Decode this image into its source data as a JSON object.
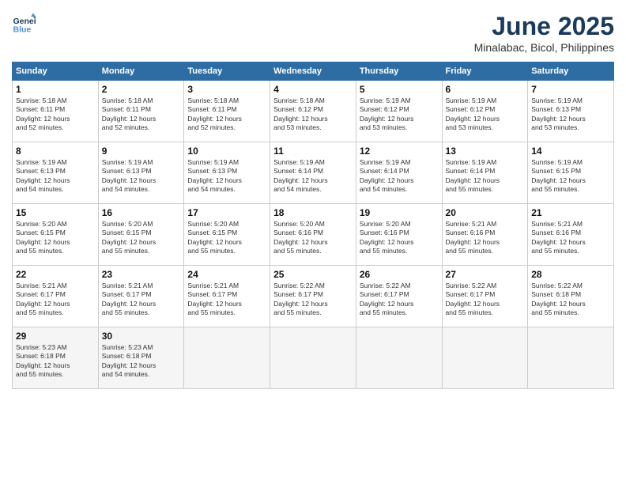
{
  "header": {
    "title": "June 2025",
    "subtitle": "Minalabac, Bicol, Philippines"
  },
  "columns": [
    "Sunday",
    "Monday",
    "Tuesday",
    "Wednesday",
    "Thursday",
    "Friday",
    "Saturday"
  ],
  "weeks": [
    [
      {
        "day": "1",
        "info": "Sunrise: 5:18 AM\nSunset: 6:11 PM\nDaylight: 12 hours\nand 52 minutes."
      },
      {
        "day": "2",
        "info": "Sunrise: 5:18 AM\nSunset: 6:11 PM\nDaylight: 12 hours\nand 52 minutes."
      },
      {
        "day": "3",
        "info": "Sunrise: 5:18 AM\nSunset: 6:11 PM\nDaylight: 12 hours\nand 52 minutes."
      },
      {
        "day": "4",
        "info": "Sunrise: 5:18 AM\nSunset: 6:12 PM\nDaylight: 12 hours\nand 53 minutes."
      },
      {
        "day": "5",
        "info": "Sunrise: 5:19 AM\nSunset: 6:12 PM\nDaylight: 12 hours\nand 53 minutes."
      },
      {
        "day": "6",
        "info": "Sunrise: 5:19 AM\nSunset: 6:12 PM\nDaylight: 12 hours\nand 53 minutes."
      },
      {
        "day": "7",
        "info": "Sunrise: 5:19 AM\nSunset: 6:13 PM\nDaylight: 12 hours\nand 53 minutes."
      }
    ],
    [
      {
        "day": "8",
        "info": "Sunrise: 5:19 AM\nSunset: 6:13 PM\nDaylight: 12 hours\nand 54 minutes."
      },
      {
        "day": "9",
        "info": "Sunrise: 5:19 AM\nSunset: 6:13 PM\nDaylight: 12 hours\nand 54 minutes."
      },
      {
        "day": "10",
        "info": "Sunrise: 5:19 AM\nSunset: 6:13 PM\nDaylight: 12 hours\nand 54 minutes."
      },
      {
        "day": "11",
        "info": "Sunrise: 5:19 AM\nSunset: 6:14 PM\nDaylight: 12 hours\nand 54 minutes."
      },
      {
        "day": "12",
        "info": "Sunrise: 5:19 AM\nSunset: 6:14 PM\nDaylight: 12 hours\nand 54 minutes."
      },
      {
        "day": "13",
        "info": "Sunrise: 5:19 AM\nSunset: 6:14 PM\nDaylight: 12 hours\nand 55 minutes."
      },
      {
        "day": "14",
        "info": "Sunrise: 5:19 AM\nSunset: 6:15 PM\nDaylight: 12 hours\nand 55 minutes."
      }
    ],
    [
      {
        "day": "15",
        "info": "Sunrise: 5:20 AM\nSunset: 6:15 PM\nDaylight: 12 hours\nand 55 minutes."
      },
      {
        "day": "16",
        "info": "Sunrise: 5:20 AM\nSunset: 6:15 PM\nDaylight: 12 hours\nand 55 minutes."
      },
      {
        "day": "17",
        "info": "Sunrise: 5:20 AM\nSunset: 6:15 PM\nDaylight: 12 hours\nand 55 minutes."
      },
      {
        "day": "18",
        "info": "Sunrise: 5:20 AM\nSunset: 6:16 PM\nDaylight: 12 hours\nand 55 minutes."
      },
      {
        "day": "19",
        "info": "Sunrise: 5:20 AM\nSunset: 6:16 PM\nDaylight: 12 hours\nand 55 minutes."
      },
      {
        "day": "20",
        "info": "Sunrise: 5:21 AM\nSunset: 6:16 PM\nDaylight: 12 hours\nand 55 minutes."
      },
      {
        "day": "21",
        "info": "Sunrise: 5:21 AM\nSunset: 6:16 PM\nDaylight: 12 hours\nand 55 minutes."
      }
    ],
    [
      {
        "day": "22",
        "info": "Sunrise: 5:21 AM\nSunset: 6:17 PM\nDaylight: 12 hours\nand 55 minutes."
      },
      {
        "day": "23",
        "info": "Sunrise: 5:21 AM\nSunset: 6:17 PM\nDaylight: 12 hours\nand 55 minutes."
      },
      {
        "day": "24",
        "info": "Sunrise: 5:21 AM\nSunset: 6:17 PM\nDaylight: 12 hours\nand 55 minutes."
      },
      {
        "day": "25",
        "info": "Sunrise: 5:22 AM\nSunset: 6:17 PM\nDaylight: 12 hours\nand 55 minutes."
      },
      {
        "day": "26",
        "info": "Sunrise: 5:22 AM\nSunset: 6:17 PM\nDaylight: 12 hours\nand 55 minutes."
      },
      {
        "day": "27",
        "info": "Sunrise: 5:22 AM\nSunset: 6:17 PM\nDaylight: 12 hours\nand 55 minutes."
      },
      {
        "day": "28",
        "info": "Sunrise: 5:22 AM\nSunset: 6:18 PM\nDaylight: 12 hours\nand 55 minutes."
      }
    ],
    [
      {
        "day": "29",
        "info": "Sunrise: 5:23 AM\nSunset: 6:18 PM\nDaylight: 12 hours\nand 55 minutes."
      },
      {
        "day": "30",
        "info": "Sunrise: 5:23 AM\nSunset: 6:18 PM\nDaylight: 12 hours\nand 54 minutes."
      },
      {
        "day": "",
        "info": ""
      },
      {
        "day": "",
        "info": ""
      },
      {
        "day": "",
        "info": ""
      },
      {
        "day": "",
        "info": ""
      },
      {
        "day": "",
        "info": ""
      }
    ]
  ]
}
